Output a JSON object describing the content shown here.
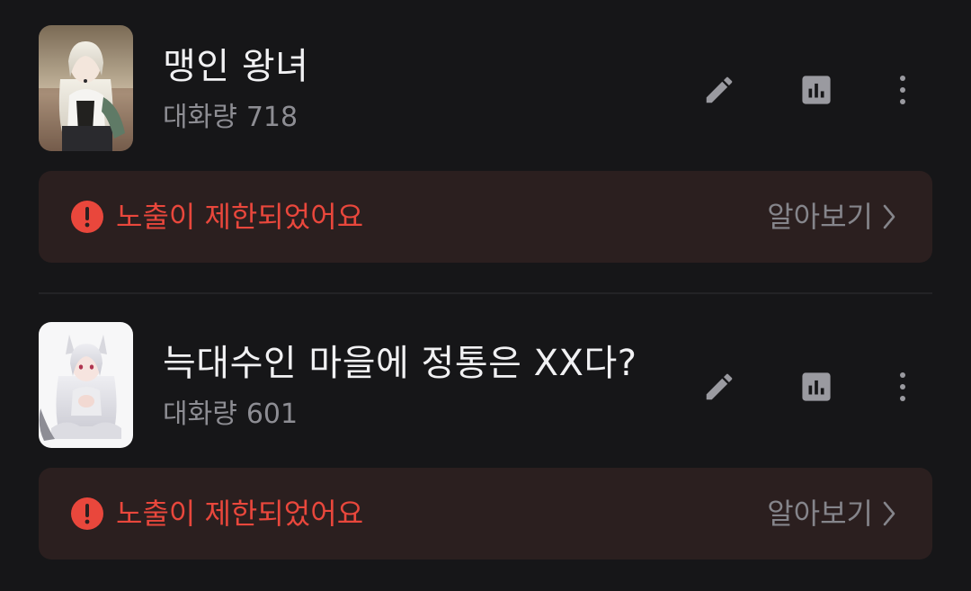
{
  "colors": {
    "background": "#161618",
    "banner_background": "#2b1f1f",
    "alert_red": "#e9473c",
    "title_text": "#f1f1f3",
    "muted_text": "#8d8d93",
    "icon_gray": "#9a9aa0"
  },
  "icons": {
    "edit": "pencil-icon",
    "stats": "bar-chart-icon",
    "more": "more-vertical-icon",
    "alert": "exclamation-circle-icon",
    "learn_more": "chevron-right-icon"
  },
  "characters": [
    {
      "title": "맹인 왕녀",
      "count_label": "대화량",
      "count_value": "718",
      "thumbnail": "character-avatar-image",
      "banner": {
        "message": "노출이 제한되었어요",
        "action_label": "알아보기"
      }
    },
    {
      "title": "늑대수인 마을에 정통은 XX다?",
      "count_label": "대화량",
      "count_value": "601",
      "thumbnail": "character-avatar-image",
      "banner": {
        "message": "노출이 제한되었어요",
        "action_label": "알아보기"
      }
    }
  ]
}
